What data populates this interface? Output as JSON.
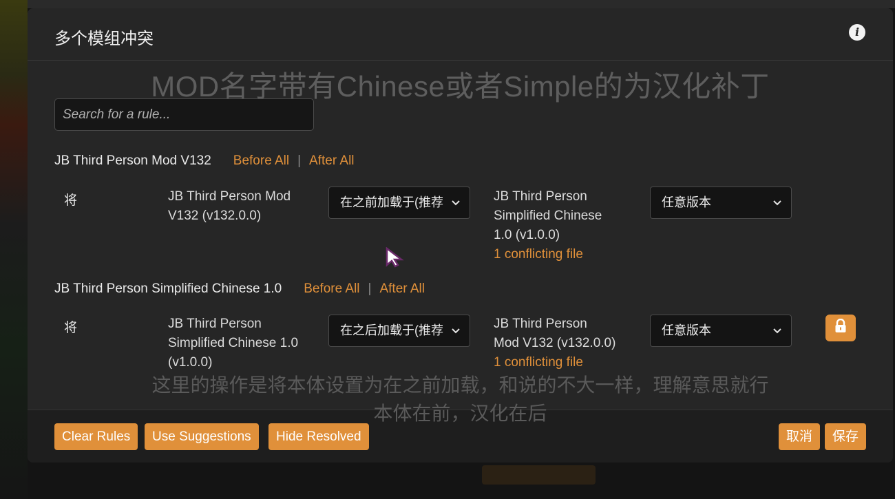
{
  "modal": {
    "title": "多个模组冲突"
  },
  "subtitles": {
    "top": "MOD名字带有Chinese或者Simple的为汉化补丁",
    "bottom_line1": "这里的操作是将本体设置为在之前加载，和说的不大一样，理解意思就行",
    "bottom_line2": "本体在前，汉化在后"
  },
  "search": {
    "placeholder": "Search for a rule..."
  },
  "groups": [
    {
      "name": "JB Third Person Mod V132",
      "before_all": "Before All",
      "after_all": "After All",
      "rule": {
        "label": "将",
        "source_line1": "JB Third Person Mod",
        "source_line2": "V132 (v132.0.0)",
        "relation": "在之前加载于(推荐",
        "target_line1": "JB Third Person",
        "target_line2": "Simplified Chinese",
        "target_line3": "1.0 (v1.0.0)",
        "conflict": "1 conflicting file",
        "version": "任意版本"
      }
    },
    {
      "name": "JB Third Person Simplified Chinese 1.0",
      "before_all": "Before All",
      "after_all": "After All",
      "rule": {
        "label": "将",
        "source_line1": "JB Third Person",
        "source_line2": "Simplified Chinese 1.0",
        "source_line3": "(v1.0.0)",
        "relation": "在之后加载于(推荐",
        "target_line1": "JB Third Person",
        "target_line2": "Mod V132 (v132.0.0)",
        "conflict": "1 conflicting file",
        "version": "任意版本"
      }
    }
  ],
  "footer": {
    "clear_rules": "Clear Rules",
    "use_suggestions": "Use Suggestions",
    "hide_resolved": "Hide Resolved",
    "cancel": "取消",
    "save": "保存"
  },
  "colors": {
    "accent": "#e0903a",
    "modal_bg": "#262626",
    "footer_bg": "#1e1e1e"
  }
}
